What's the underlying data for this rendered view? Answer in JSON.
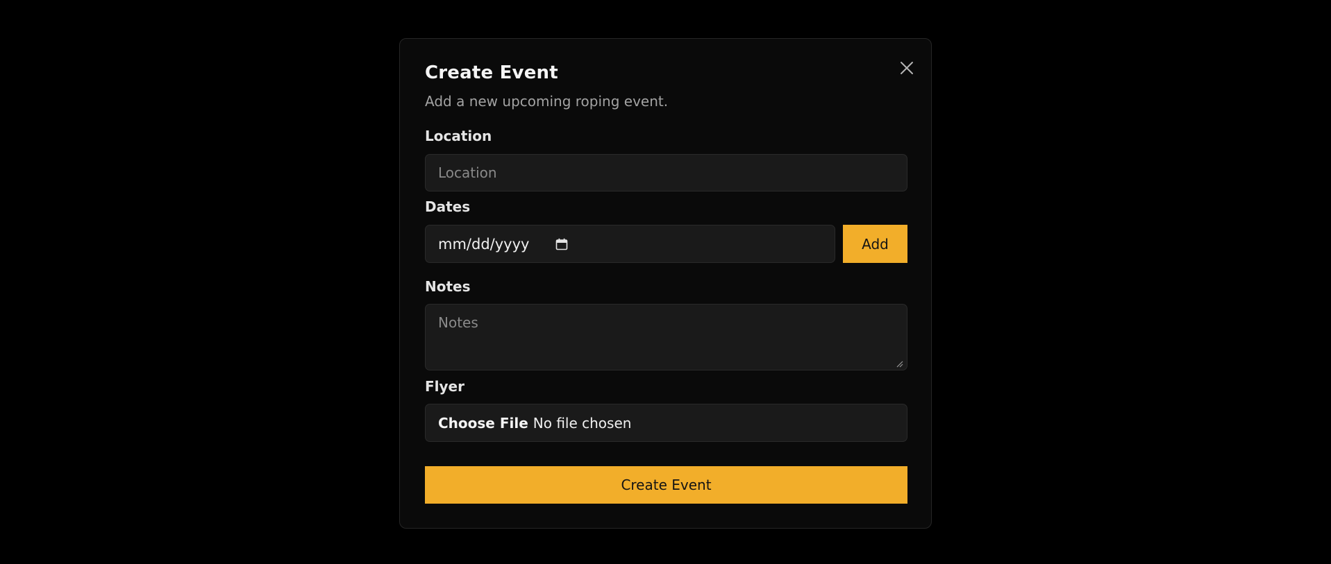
{
  "dialog": {
    "title": "Create Event",
    "subtitle": "Add a new upcoming roping event.",
    "close_icon": "close-icon"
  },
  "location": {
    "label": "Location",
    "placeholder": "Location",
    "value": ""
  },
  "dates": {
    "label": "Dates",
    "value_display": "mm/dd/yyyy",
    "calendar_icon": "calendar-icon",
    "add_label": "Add"
  },
  "notes": {
    "label": "Notes",
    "placeholder": "Notes",
    "value": ""
  },
  "flyer": {
    "label": "Flyer",
    "choose_label": "Choose File",
    "status": "No file chosen"
  },
  "submit": {
    "label": "Create Event"
  },
  "colors": {
    "accent": "#f2ae2a",
    "background": "#000000",
    "panel": "#0a0a0a",
    "input": "#1a1a1a"
  }
}
